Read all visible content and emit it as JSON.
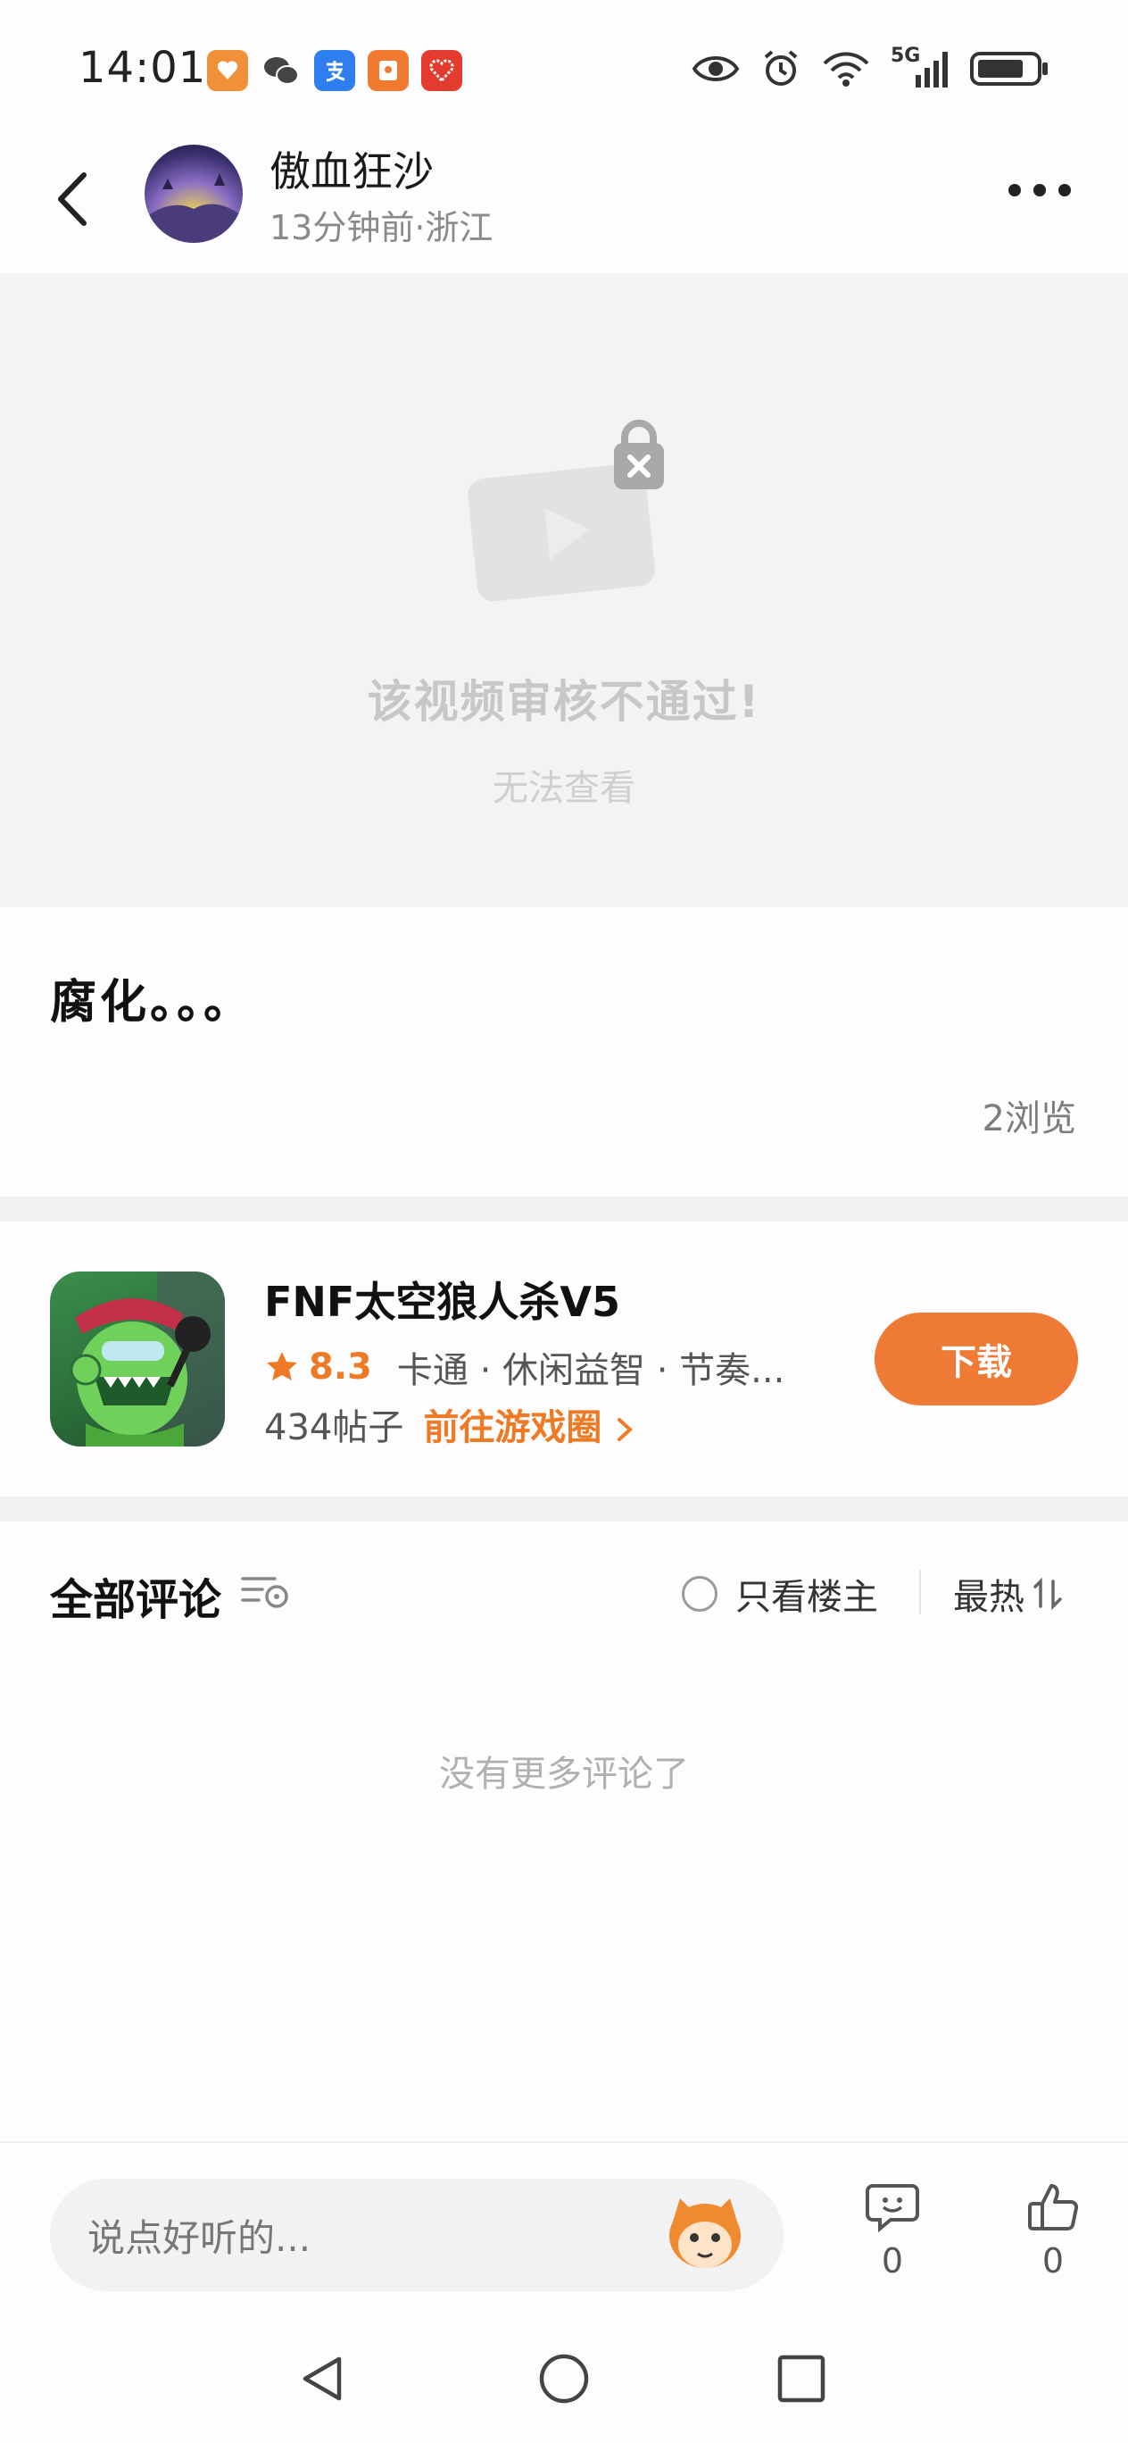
{
  "status_bar": {
    "time": "14:01",
    "notification_icons": [
      "taobao-icon",
      "wechat-icon",
      "alipay-icon",
      "redpacket-icon",
      "health-app-icon"
    ],
    "system_icons": [
      "eye-icon",
      "alarm-icon",
      "wifi-icon",
      "5g-signal-icon",
      "battery-icon"
    ],
    "network_label": "5G"
  },
  "header": {
    "author": "傲血狂沙",
    "meta": "13分钟前·浙江"
  },
  "video": {
    "title": "该视频审核不通过!",
    "subtitle": "无法查看"
  },
  "post": {
    "title": "腐化。。。",
    "views": "2浏览"
  },
  "game": {
    "name": "FNF太空狼人杀V5",
    "rating": "8.3",
    "tags": "卡通 · 休闲益智 · 节奏...",
    "posts": "434帖子",
    "goto_label": "前往游戏圈",
    "download_label": "下载"
  },
  "comments": {
    "title": "全部评论",
    "owner_only_label": "只看楼主",
    "sort_label": "最热",
    "empty_text": "没有更多评论了"
  },
  "bottom_bar": {
    "input_placeholder": "说点好听的...",
    "comment_count": "0",
    "like_count": "0"
  },
  "colors": {
    "accent": "#ef7a35",
    "rating": "#ef7a24"
  }
}
